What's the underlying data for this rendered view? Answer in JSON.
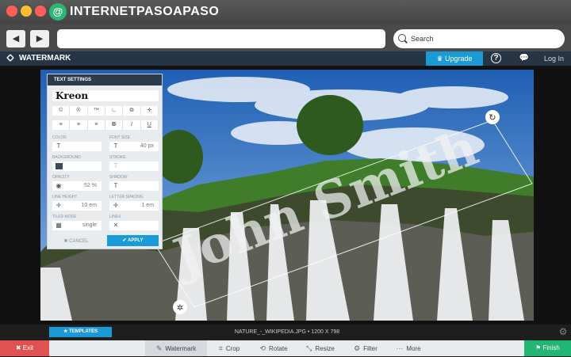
{
  "browser": {
    "logo_letter": "@",
    "logo_text": "INTERNETPASOAPASO",
    "back_label": "◀",
    "forward_label": "▶",
    "search_placeholder": "Search",
    "traffic_colors": [
      "#ff5f56",
      "#ffbd2e",
      "#ff5f56"
    ]
  },
  "app": {
    "brand": "WATERMARK",
    "upgrade_label": "Upgrade",
    "help_label": "?",
    "chat_label": "💬",
    "login_label": "Log In"
  },
  "watermark": {
    "text": "John Smith",
    "rotate_handle": "↻",
    "resize_handle": "✲"
  },
  "settings": {
    "title": "TEXT SETTINGS",
    "font": "Kreon",
    "row1": [
      "©",
      "®",
      "™",
      "∟",
      "⧉",
      "✛"
    ],
    "row2": [
      "≡",
      "≡",
      "≡",
      "B",
      "I",
      "U"
    ],
    "color_label": "COLOR",
    "font_size_label": "FONT SIZE",
    "font_size_value": "40 px",
    "background_label": "BACKGROUND",
    "stroke_label": "STROKE",
    "opacity_label": "OPACITY",
    "opacity_value": "52 %",
    "shadow_label": "SHADOW",
    "line_height_label": "LINE HEIGHT",
    "line_height_value": "10 em",
    "letter_spacing_label": "LETTER SPACING",
    "letter_spacing_value": "1 em",
    "tiled_mode_label": "TILED MODE",
    "tiled_mode_value": "single",
    "lines_label": "LINES",
    "cancel_label": "✖ CANCEL",
    "apply_label": "✔ APPLY"
  },
  "footer": {
    "templates_label": "★ TEMPLATES",
    "filename": "NATURE_-_WIKIPEDIA.JPG • 1200 X 798",
    "exit_label": "✖ Exit",
    "finish_label": "⚑ Finish",
    "tools": [
      {
        "icon": "✎",
        "label": "Watermark"
      },
      {
        "icon": "⌗",
        "label": "Crop"
      },
      {
        "icon": "⟲",
        "label": "Rotate"
      },
      {
        "icon": "⤡",
        "label": "Resize"
      },
      {
        "icon": "⚙",
        "label": "Filter"
      },
      {
        "icon": "···",
        "label": "More"
      }
    ]
  },
  "colors": {
    "accent": "#1a9ad6",
    "exit": "#e05252",
    "finish": "#22b573",
    "header": "#263546"
  }
}
